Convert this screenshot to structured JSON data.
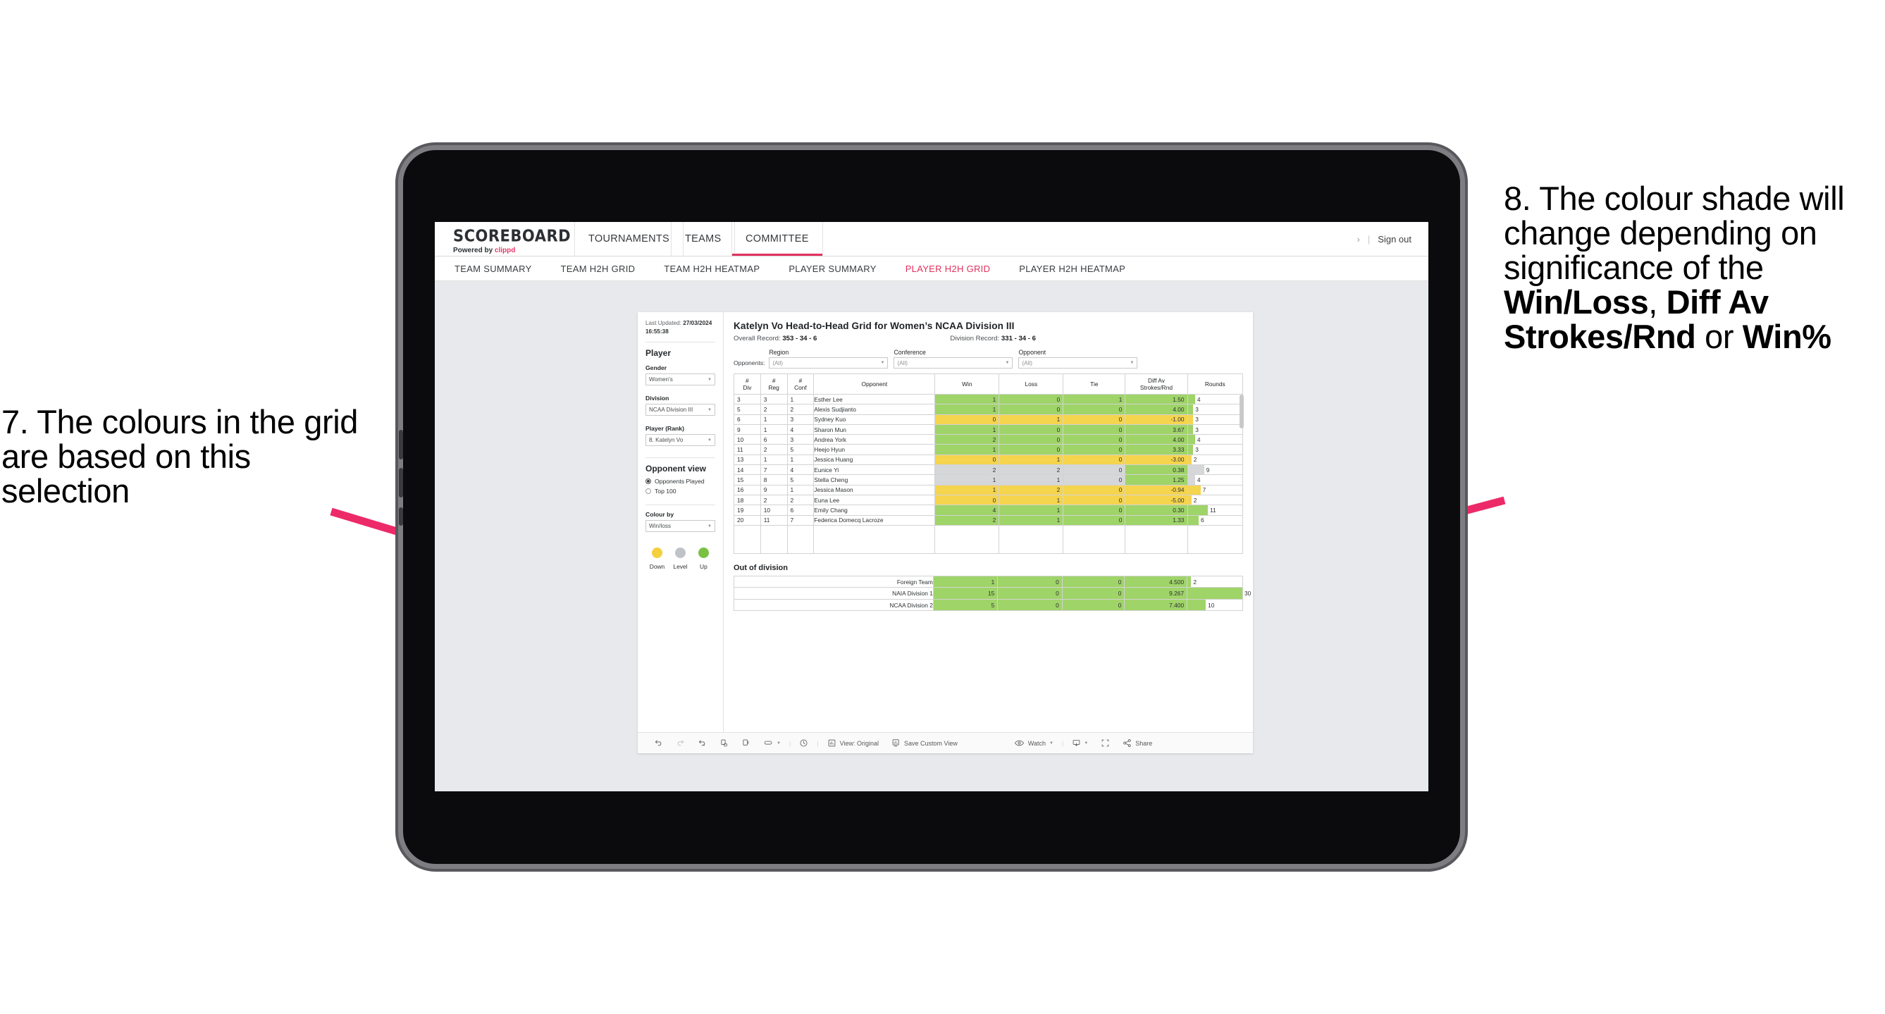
{
  "annotations": {
    "left": "7. The colours in the grid are based on this selection",
    "right_pre": "8. The colour shade will change depending on significance of the ",
    "right_b1": "Win/Loss",
    "right_mid1": ", ",
    "right_b2": "Diff Av Strokes/Rnd",
    "right_mid2": " or ",
    "right_b3": "Win%",
    "arrow_color": "#ed2a68"
  },
  "app": {
    "logo_word": "SCOREBOARD",
    "logo_sub_prefix": "Powered by ",
    "logo_sub_brand": "clippd",
    "top_nav": [
      {
        "label": "TOURNAMENTS",
        "selected": false
      },
      {
        "label": "TEAMS",
        "selected": false
      },
      {
        "label": "COMMITTEE",
        "selected": true
      }
    ],
    "sign_out": "Sign out",
    "sign_out_chevron": "›",
    "sign_out_divider": "|",
    "sub_nav": [
      {
        "label": "TEAM SUMMARY",
        "active": false
      },
      {
        "label": "TEAM H2H GRID",
        "active": false
      },
      {
        "label": "TEAM H2H HEATMAP",
        "active": false
      },
      {
        "label": "PLAYER SUMMARY",
        "active": false
      },
      {
        "label": "PLAYER H2H GRID",
        "active": true
      },
      {
        "label": "PLAYER H2H HEATMAP",
        "active": false
      }
    ],
    "accent": "#e0315d"
  },
  "filters": {
    "last_updated_label": "Last Updated: ",
    "last_updated_value": "27/03/2024 16:55:38",
    "player_heading": "Player",
    "gender_label": "Gender",
    "gender_value": "Women’s",
    "division_label": "Division",
    "division_value": "NCAA Division III",
    "player_rank_label": "Player (Rank)",
    "player_rank_value": "8. Katelyn Vo",
    "opponent_view_heading": "Opponent view",
    "opponent_view_options": [
      {
        "label": "Opponents Played",
        "selected": true
      },
      {
        "label": "Top 100",
        "selected": false
      }
    ],
    "colour_by_label": "Colour by",
    "colour_by_value": "Win/loss",
    "legend": [
      {
        "caption": "Down",
        "color": "#f5cf3d"
      },
      {
        "caption": "Level",
        "color": "#bfc3c7"
      },
      {
        "caption": "Up",
        "color": "#7ac143"
      }
    ]
  },
  "viz": {
    "title": "Katelyn Vo Head-to-Head Grid for Women’s NCAA Division III",
    "overall_record_label": "Overall Record: ",
    "overall_record_value": "353 - 34 - 6",
    "division_record_label": "Division Record: ",
    "division_record_value": "331 - 34 - 6",
    "opponents_label": "Opponents:",
    "opponent_filters": [
      {
        "caption": "Region",
        "value": "(All)"
      },
      {
        "caption": "Conference",
        "value": "(All)"
      },
      {
        "caption": "Opponent",
        "value": "(All)"
      }
    ],
    "out_of_division_heading": "Out of division"
  },
  "chart_data": {
    "type": "table",
    "title": "Katelyn Vo Head-to-Head Grid for Women’s NCAA Division III",
    "columns": [
      "# Div",
      "# Reg",
      "# Conf",
      "Opponent",
      "Win",
      "Loss",
      "Tie",
      "Diff Av Strokes/Rnd",
      "Rounds"
    ],
    "column_lines": [
      [
        "#",
        "Div"
      ],
      [
        "#",
        "Reg"
      ],
      [
        "#",
        "Conf"
      ],
      [
        "Opponent"
      ],
      [
        "Win"
      ],
      [
        "Loss"
      ],
      [
        "Tie"
      ],
      [
        "Diff Av",
        "Strokes/Rnd"
      ],
      [
        "Rounds"
      ]
    ],
    "rounds_max": 30,
    "rows": [
      {
        "div": "3",
        "reg": "3",
        "conf": "1",
        "opponent": "Esther Lee",
        "win": "1",
        "loss": "0",
        "tie": "1",
        "diff": "1.50",
        "rounds": "4",
        "shade": "up"
      },
      {
        "div": "5",
        "reg": "2",
        "conf": "2",
        "opponent": "Alexis Sudjianto",
        "win": "1",
        "loss": "0",
        "tie": "0",
        "diff": "4.00",
        "rounds": "3",
        "shade": "up"
      },
      {
        "div": "6",
        "reg": "1",
        "conf": "3",
        "opponent": "Sydney Kuo",
        "win": "0",
        "loss": "1",
        "tie": "0",
        "diff": "-1.00",
        "rounds": "3",
        "shade": "down"
      },
      {
        "div": "9",
        "reg": "1",
        "conf": "4",
        "opponent": "Sharon Mun",
        "win": "1",
        "loss": "0",
        "tie": "0",
        "diff": "3.67",
        "rounds": "3",
        "shade": "up"
      },
      {
        "div": "10",
        "reg": "6",
        "conf": "3",
        "opponent": "Andrea York",
        "win": "2",
        "loss": "0",
        "tie": "0",
        "diff": "4.00",
        "rounds": "4",
        "shade": "up"
      },
      {
        "div": "11",
        "reg": "2",
        "conf": "5",
        "opponent": "Heejo Hyun",
        "win": "1",
        "loss": "0",
        "tie": "0",
        "diff": "3.33",
        "rounds": "3",
        "shade": "up"
      },
      {
        "div": "13",
        "reg": "1",
        "conf": "1",
        "opponent": "Jessica Huang",
        "win": "0",
        "loss": "1",
        "tie": "0",
        "diff": "-3.00",
        "rounds": "2",
        "shade": "down"
      },
      {
        "div": "14",
        "reg": "7",
        "conf": "4",
        "opponent": "Eunice Yi",
        "win": "2",
        "loss": "2",
        "tie": "0",
        "diff": "0.38",
        "rounds": "9",
        "shade": "level",
        "diff_shade": "up"
      },
      {
        "div": "15",
        "reg": "8",
        "conf": "5",
        "opponent": "Stella Cheng",
        "win": "1",
        "loss": "1",
        "tie": "0",
        "diff": "1.25",
        "rounds": "4",
        "shade": "level",
        "diff_shade": "up"
      },
      {
        "div": "16",
        "reg": "9",
        "conf": "1",
        "opponent": "Jessica Mason",
        "win": "1",
        "loss": "2",
        "tie": "0",
        "diff": "-0.94",
        "rounds": "7",
        "shade": "down"
      },
      {
        "div": "18",
        "reg": "2",
        "conf": "2",
        "opponent": "Euna Lee",
        "win": "0",
        "loss": "1",
        "tie": "0",
        "diff": "-5.00",
        "rounds": "2",
        "shade": "down"
      },
      {
        "div": "19",
        "reg": "10",
        "conf": "6",
        "opponent": "Emily Chang",
        "win": "4",
        "loss": "1",
        "tie": "0",
        "diff": "0.30",
        "rounds": "11",
        "shade": "up"
      },
      {
        "div": "20",
        "reg": "11",
        "conf": "7",
        "opponent": "Federica Domecq Lacroze",
        "win": "2",
        "loss": "1",
        "tie": "0",
        "diff": "1.33",
        "rounds": "6",
        "shade": "up"
      }
    ],
    "out_of_division": {
      "heading": "Out of division",
      "rounds_max": 30,
      "rows": [
        {
          "name": "Foreign Team",
          "win": "1",
          "loss": "0",
          "tie": "0",
          "diff": "4.500",
          "rounds": "2",
          "shade": "up"
        },
        {
          "name": "NAIA Division 1",
          "win": "15",
          "loss": "0",
          "tie": "0",
          "diff": "9.267",
          "rounds": "30",
          "shade": "up"
        },
        {
          "name": "NCAA Division 2",
          "win": "5",
          "loss": "0",
          "tie": "0",
          "diff": "7.400",
          "rounds": "10",
          "shade": "up"
        }
      ]
    }
  },
  "toolbar": {
    "view_label": "View: Original",
    "save_label": "Save Custom View",
    "watch_label": "Watch",
    "share_label": "Share",
    "caret": "▾",
    "divider": "|"
  }
}
